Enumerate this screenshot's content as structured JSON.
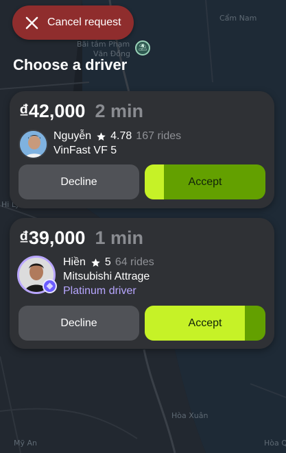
{
  "map": {
    "labels": [
      "Bãi tắm Phạm",
      "Văn Đồng",
      "Hi Ly",
      "Mỹ An",
      "Hòa Xuân",
      "Cẩm Nam",
      "Hòa Quý"
    ]
  },
  "cancel": {
    "label": "Cancel request",
    "icon": "close-icon"
  },
  "title": "Choose a driver",
  "offers": [
    {
      "price": "₫42,000",
      "eta": "2 min",
      "driver": {
        "name": "Nguyễn",
        "rating": "4.78",
        "rides": "167 rides",
        "car": "VinFast VF 5",
        "tier": ""
      },
      "decline_label": "Decline",
      "accept_label": "Accept",
      "accept_timer_remaining": 0.16
    },
    {
      "price": "₫39,000",
      "eta": "1 min",
      "driver": {
        "name": "Hiền",
        "rating": "5",
        "rides": "64 rides",
        "car": "Mitsubishi Attrage",
        "tier": "Platinum driver"
      },
      "decline_label": "Decline",
      "accept_label": "Accept",
      "accept_timer_remaining": 0.83
    }
  ],
  "colors": {
    "accept": "#c6f227",
    "accept_elapsed": "#63a000",
    "cancel": "#8f2d2d",
    "tier": "#b7a6ff"
  }
}
